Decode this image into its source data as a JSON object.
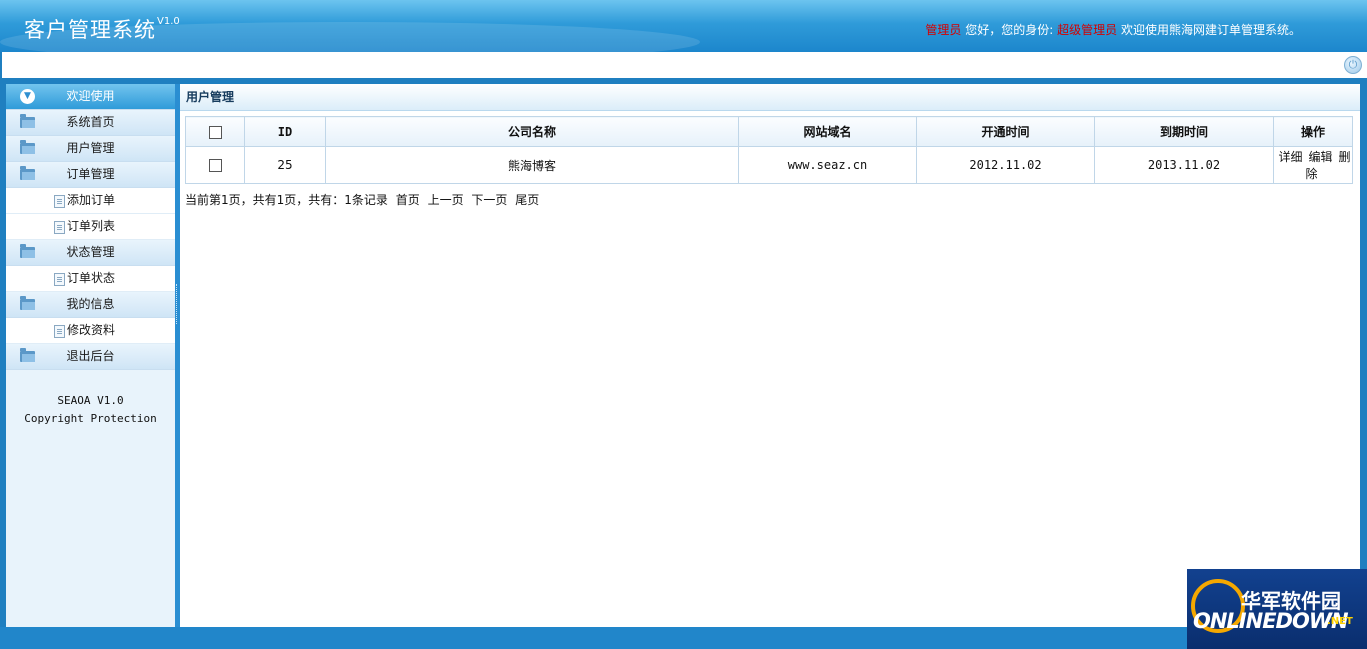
{
  "header": {
    "title": "客户管理系统",
    "version": "V1.0",
    "welcome": {
      "role_name": "管理员",
      "greeting": "您好，您的身份:",
      "identity": "超级管理员",
      "message": "欢迎使用熊海网建订单管理系统。"
    }
  },
  "sidebar": {
    "items": [
      {
        "type": "menu",
        "label": "欢迎使用",
        "active": true
      },
      {
        "type": "menu",
        "label": "系统首页"
      },
      {
        "type": "menu",
        "label": "用户管理"
      },
      {
        "type": "menu",
        "label": "订单管理"
      },
      {
        "type": "sub",
        "label": "添加订单"
      },
      {
        "type": "sub",
        "label": "订单列表"
      },
      {
        "type": "menu",
        "label": "状态管理"
      },
      {
        "type": "sub",
        "label": "订单状态"
      },
      {
        "type": "menu",
        "label": "我的信息"
      },
      {
        "type": "sub",
        "label": "修改资料"
      },
      {
        "type": "menu",
        "label": "退出后台"
      }
    ],
    "footer_line1": "SEAOA V1.0",
    "footer_line2": "Copyright Protection"
  },
  "content": {
    "title": "用户管理",
    "columns": [
      "ID",
      "公司名称",
      "网站域名",
      "开通时间",
      "到期时间",
      "操作"
    ],
    "rows": [
      {
        "id": "25",
        "company": "熊海博客",
        "domain": "www.seaz.cn",
        "open_date": "2012.11.02",
        "expire_date": "2013.11.02",
        "actions": [
          "详细",
          "编辑",
          "删除"
        ]
      }
    ],
    "pager": {
      "info": "当前第1页，共有1页，共有：1条记录",
      "first": "首页",
      "prev": "上一页",
      "next": "下一页",
      "last": "尾页"
    }
  },
  "watermark": {
    "cn": "华军软件园",
    "en": "ONLINEDOWN",
    "net": ".NET"
  },
  "icons": {
    "power": "power-icon",
    "folder": "folder-icon",
    "document": "document-icon",
    "expand": "chevron-down-icon"
  },
  "colors": {
    "header_blue": "#2f9bd9",
    "highlight_red": "#d40000",
    "frame_blue": "#1f7fc0"
  }
}
